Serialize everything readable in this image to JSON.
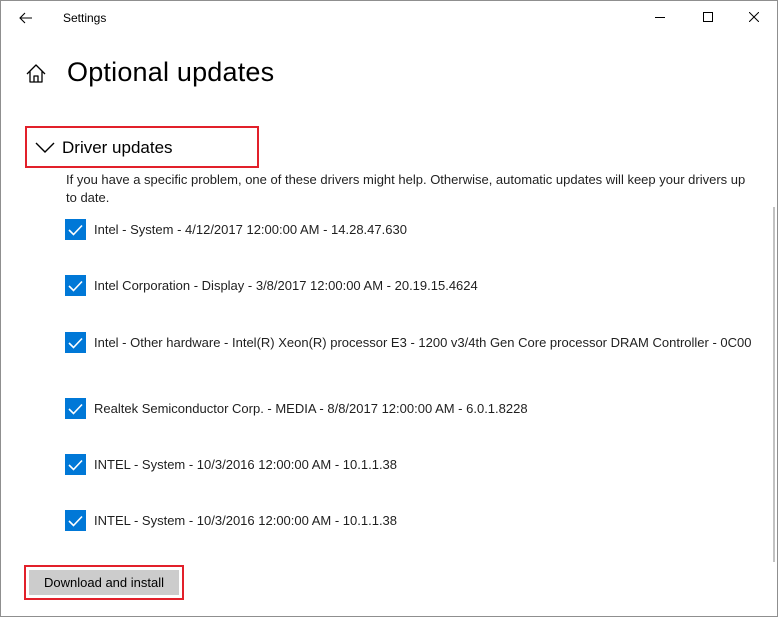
{
  "window": {
    "title": "Settings"
  },
  "header": {
    "title": "Optional updates"
  },
  "section": {
    "label": "Driver updates",
    "description": "If you have a specific problem, one of these drivers might help. Otherwise, automatic updates will keep your drivers up to date."
  },
  "drivers": [
    {
      "label": "Intel - System - 4/12/2017 12:00:00 AM - 14.28.47.630",
      "checked": true
    },
    {
      "label": "Intel Corporation - Display - 3/8/2017 12:00:00 AM - 20.19.15.4624",
      "checked": true
    },
    {
      "label": "Intel - Other hardware - Intel(R) Xeon(R) processor E3 - 1200 v3/4th Gen Core processor DRAM Controller - 0C00",
      "checked": true
    },
    {
      "label": "Realtek Semiconductor Corp. - MEDIA - 8/8/2017 12:00:00 AM - 6.0.1.8228",
      "checked": true
    },
    {
      "label": "INTEL - System - 10/3/2016 12:00:00 AM - 10.1.1.38",
      "checked": true
    },
    {
      "label": "INTEL - System - 10/3/2016 12:00:00 AM - 10.1.1.38",
      "checked": true
    }
  ],
  "actions": {
    "download_label": "Download and install"
  },
  "colors": {
    "accent": "#0078d7",
    "highlight": "#e2202a",
    "button_bg": "#cccccc"
  },
  "icons": {
    "back": "back-arrow-icon",
    "home": "home-icon",
    "minimize": "minimize-icon",
    "maximize": "maximize-icon",
    "close": "close-icon",
    "chevron": "chevron-down-icon",
    "check": "checkmark-icon"
  }
}
